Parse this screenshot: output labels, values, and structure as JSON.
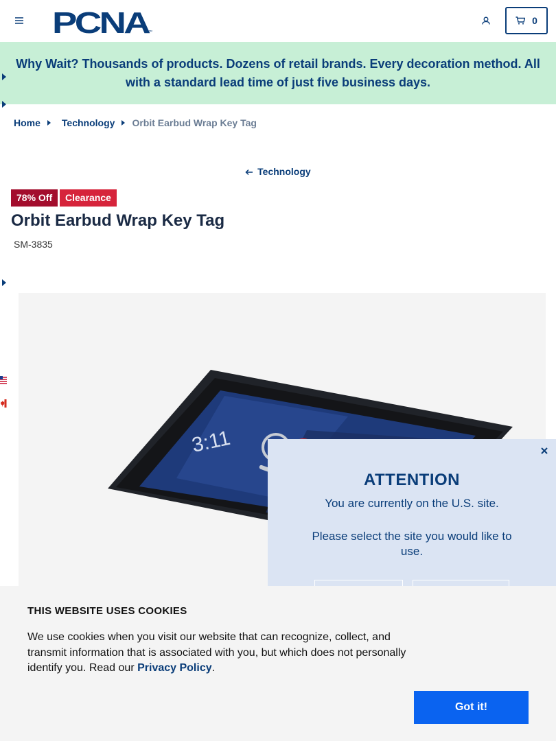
{
  "brand": {
    "logo_text": "PCNA",
    "color": "#0a3d79"
  },
  "header": {
    "cart_count": "0"
  },
  "promo": {
    "text": "Why Wait? Thousands of products. Dozens of retail brands. Every decoration method. All with a standard lead time of just five business days.",
    "bg": "#c7efd6"
  },
  "breadcrumb": {
    "home": "Home",
    "category": "Technology",
    "current": "Orbit Earbud Wrap Key Tag"
  },
  "back_link": {
    "label": "Technology"
  },
  "product": {
    "discount_badge": "78% Off",
    "clearance_badge": "Clearance",
    "title": "Orbit Earbud Wrap Key Tag",
    "sku": "SM-3835",
    "image_time": "3:11"
  },
  "site_modal": {
    "title": "ATTENTION",
    "line1": "You are currently on the U.S. site.",
    "line2": "Please select the site you would like to use."
  },
  "cookie_banner": {
    "title": "THIS WEBSITE USES COOKIES",
    "text": "We use cookies when you visit our website that can recognize, collect, and transmit information that is associated with you, but which does not personally identify you. Read our ",
    "link": "Privacy Policy",
    "period": ".",
    "button": "Got it!",
    "button_color": "#0a63f0"
  },
  "icons": [
    "menu-icon",
    "account-icon",
    "cart-icon",
    "close-icon",
    "arrow-left-icon",
    "us-flag-icon",
    "canada-flag-icon"
  ]
}
